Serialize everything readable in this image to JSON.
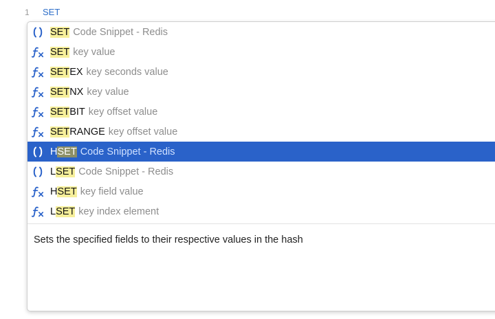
{
  "editor": {
    "line_number": "1",
    "line_text": "SET"
  },
  "autocomplete": {
    "items": [
      {
        "icon": "snippet-icon",
        "prefix": "",
        "match": "SET",
        "suffix": "",
        "detail": "Code Snippet - Redis"
      },
      {
        "icon": "function-icon",
        "prefix": "",
        "match": "SET",
        "suffix": "",
        "detail": "key value"
      },
      {
        "icon": "function-icon",
        "prefix": "",
        "match": "SET",
        "suffix": "EX",
        "detail": "key seconds value"
      },
      {
        "icon": "function-icon",
        "prefix": "",
        "match": "SET",
        "suffix": "NX",
        "detail": "key value"
      },
      {
        "icon": "function-icon",
        "prefix": "",
        "match": "SET",
        "suffix": "BIT",
        "detail": "key offset value"
      },
      {
        "icon": "function-icon",
        "prefix": "",
        "match": "SET",
        "suffix": "RANGE",
        "detail": "key offset value"
      },
      {
        "icon": "snippet-icon",
        "prefix": "H",
        "match": "SET",
        "suffix": "",
        "detail": "Code Snippet - Redis",
        "selected": true
      },
      {
        "icon": "snippet-icon",
        "prefix": "L",
        "match": "SET",
        "suffix": "",
        "detail": "Code Snippet - Redis"
      },
      {
        "icon": "function-icon",
        "prefix": "H",
        "match": "SET",
        "suffix": "",
        "detail": "key field value"
      },
      {
        "icon": "function-icon",
        "prefix": "L",
        "match": "SET",
        "suffix": "",
        "detail": "key index element"
      }
    ],
    "documentation": "Sets the specified fields to their respective values in the hash"
  },
  "colors": {
    "accent": "#2a62c9",
    "match_highlight": "#f6ef9a",
    "detail_text": "#8d8d8d"
  }
}
